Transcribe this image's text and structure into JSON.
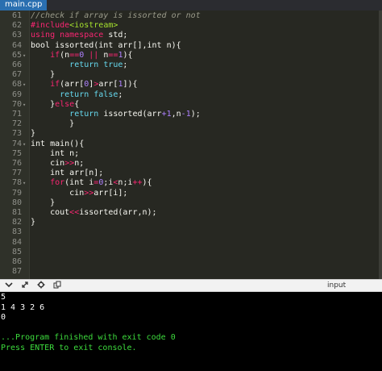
{
  "tab": {
    "label": "main.cpp"
  },
  "editor": {
    "lines": [
      {
        "n": "61",
        "fold": false,
        "segs": [
          {
            "t": "//check if array is issorted or not",
            "c": "comment"
          }
        ]
      },
      {
        "n": "62",
        "fold": false,
        "segs": [
          {
            "t": "#include",
            "c": "kw"
          },
          {
            "t": "<iostream>",
            "c": "hdr"
          }
        ]
      },
      {
        "n": "63",
        "fold": false,
        "segs": [
          {
            "t": "using namespace",
            "c": "kw"
          },
          {
            "t": " std;",
            "c": ""
          }
        ]
      },
      {
        "n": "64",
        "fold": false,
        "segs": [
          {
            "t": "bool issorted(int arr[],int n){",
            "c": ""
          }
        ]
      },
      {
        "n": "65",
        "fold": true,
        "segs": [
          {
            "t": "    ",
            "c": ""
          },
          {
            "t": "if",
            "c": "kw"
          },
          {
            "t": "(n",
            "c": ""
          },
          {
            "t": "==",
            "c": "kw"
          },
          {
            "t": "0",
            "c": "num"
          },
          {
            "t": " || ",
            "c": "kw"
          },
          {
            "t": "n",
            "c": ""
          },
          {
            "t": "==",
            "c": "kw"
          },
          {
            "t": "1",
            "c": "num"
          },
          {
            "t": "){",
            "c": ""
          }
        ]
      },
      {
        "n": "66",
        "fold": false,
        "segs": [
          {
            "t": "        ",
            "c": ""
          },
          {
            "t": "return true",
            "c": "typ"
          },
          {
            "t": ";",
            "c": ""
          }
        ]
      },
      {
        "n": "67",
        "fold": false,
        "segs": [
          {
            "t": "    }",
            "c": ""
          }
        ]
      },
      {
        "n": "68",
        "fold": true,
        "segs": [
          {
            "t": "    ",
            "c": ""
          },
          {
            "t": "if",
            "c": "kw"
          },
          {
            "t": "(arr[",
            "c": ""
          },
          {
            "t": "0",
            "c": "num"
          },
          {
            "t": "]",
            "c": ""
          },
          {
            "t": ">",
            "c": "kw"
          },
          {
            "t": "arr[",
            "c": ""
          },
          {
            "t": "1",
            "c": "num"
          },
          {
            "t": "]){",
            "c": ""
          }
        ]
      },
      {
        "n": "69",
        "fold": false,
        "segs": [
          {
            "t": "      ",
            "c": ""
          },
          {
            "t": "return false",
            "c": "typ"
          },
          {
            "t": ";",
            "c": ""
          }
        ]
      },
      {
        "n": "70",
        "fold": true,
        "segs": [
          {
            "t": "    }",
            "c": ""
          },
          {
            "t": "else",
            "c": "kw"
          },
          {
            "t": "{",
            "c": ""
          }
        ]
      },
      {
        "n": "71",
        "fold": false,
        "segs": [
          {
            "t": "        ",
            "c": ""
          },
          {
            "t": "return",
            "c": "typ"
          },
          {
            "t": " issorted(arr",
            "c": ""
          },
          {
            "t": "+1",
            "c": "num"
          },
          {
            "t": ",n",
            "c": ""
          },
          {
            "t": "-1",
            "c": "num"
          },
          {
            "t": ");",
            "c": ""
          }
        ]
      },
      {
        "n": "72",
        "fold": false,
        "segs": [
          {
            "t": "        }",
            "c": ""
          }
        ]
      },
      {
        "n": "73",
        "fold": false,
        "segs": [
          {
            "t": "}",
            "c": ""
          }
        ]
      },
      {
        "n": "74",
        "fold": true,
        "segs": [
          {
            "t": "int main(){",
            "c": ""
          }
        ]
      },
      {
        "n": "75",
        "fold": false,
        "segs": [
          {
            "t": "    int n;",
            "c": ""
          }
        ]
      },
      {
        "n": "76",
        "fold": false,
        "segs": [
          {
            "t": "    cin",
            "c": ""
          },
          {
            "t": ">>",
            "c": "kw"
          },
          {
            "t": "n;",
            "c": ""
          }
        ]
      },
      {
        "n": "77",
        "fold": false,
        "segs": [
          {
            "t": "    int arr[n];",
            "c": ""
          }
        ]
      },
      {
        "n": "78",
        "fold": true,
        "segs": [
          {
            "t": "    ",
            "c": ""
          },
          {
            "t": "for",
            "c": "kw"
          },
          {
            "t": "(int i",
            "c": ""
          },
          {
            "t": "=",
            "c": "kw"
          },
          {
            "t": "0",
            "c": "num"
          },
          {
            "t": ";i",
            "c": ""
          },
          {
            "t": "<",
            "c": "kw"
          },
          {
            "t": "n;i",
            "c": ""
          },
          {
            "t": "++",
            "c": "kw"
          },
          {
            "t": "){",
            "c": ""
          }
        ]
      },
      {
        "n": "79",
        "fold": false,
        "segs": [
          {
            "t": "        cin",
            "c": ""
          },
          {
            "t": ">>",
            "c": "kw"
          },
          {
            "t": "arr[i];",
            "c": ""
          }
        ]
      },
      {
        "n": "80",
        "fold": false,
        "segs": [
          {
            "t": "    }",
            "c": ""
          }
        ]
      },
      {
        "n": "81",
        "fold": false,
        "segs": [
          {
            "t": "    cout",
            "c": ""
          },
          {
            "t": "<<",
            "c": "kw"
          },
          {
            "t": "issorted(arr,n);",
            "c": ""
          }
        ]
      },
      {
        "n": "82",
        "fold": false,
        "segs": [
          {
            "t": "}",
            "c": ""
          }
        ]
      },
      {
        "n": "83",
        "fold": false,
        "segs": []
      },
      {
        "n": "84",
        "fold": false,
        "segs": []
      },
      {
        "n": "85",
        "fold": false,
        "segs": []
      },
      {
        "n": "86",
        "fold": false,
        "segs": []
      },
      {
        "n": "87",
        "fold": false,
        "segs": []
      }
    ]
  },
  "toolbar": {
    "icons": [
      "chevron-down-icon",
      "expand-icon",
      "gear-icon",
      "copy-icon"
    ],
    "input_label": "input"
  },
  "console": {
    "lines": [
      {
        "t": "5",
        "c": "cin"
      },
      {
        "t": "1 4 3 2 6",
        "c": "cin"
      },
      {
        "t": "0",
        "c": "cin"
      },
      {
        "t": "",
        "c": "cin"
      },
      {
        "t": "...Program finished with exit code 0",
        "c": "cout"
      },
      {
        "t": "Press ENTER to exit console.",
        "c": "cout"
      }
    ]
  }
}
